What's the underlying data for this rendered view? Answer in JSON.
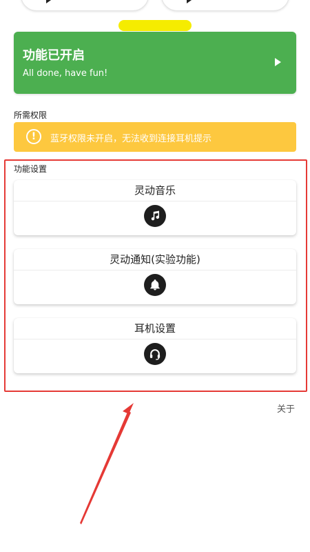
{
  "status": {
    "title": "功能已开启",
    "subtitle": "All done, have fun!"
  },
  "permissions": {
    "label": "所需权限",
    "warning_text": "蓝牙权限未开启，无法收到连接耳机提示",
    "warning_icon": "warning-circle-icon"
  },
  "features": {
    "label": "功能设置",
    "items": [
      {
        "title": "灵动音乐",
        "icon": "music-note-icon"
      },
      {
        "title": "灵动通知(实验功能)",
        "icon": "bell-icon"
      },
      {
        "title": "耳机设置",
        "icon": "headset-icon"
      }
    ]
  },
  "footer": {
    "about": "关于"
  },
  "colors": {
    "status_green": "#4caf50",
    "warning_yellow": "#fdc83f",
    "highlight_yellow": "#f5ec00",
    "annotation_red": "#e53935"
  }
}
